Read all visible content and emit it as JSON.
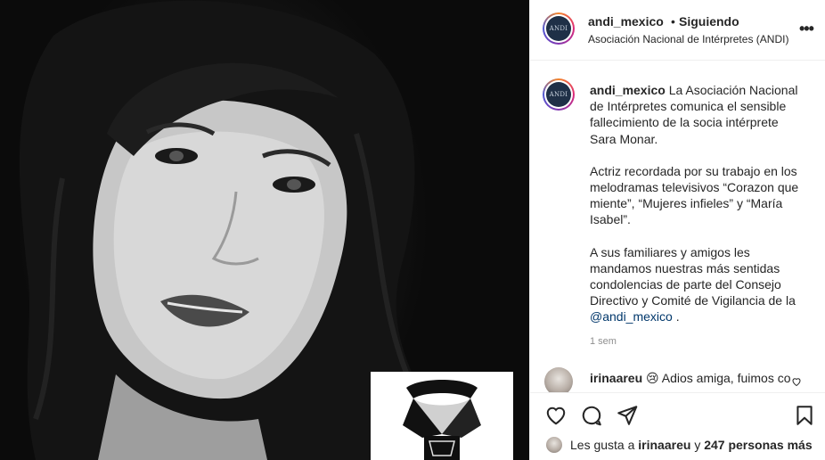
{
  "post": {
    "username": "andi_mexico",
    "separator": "•",
    "follow_status": "Siguiendo",
    "subtitle": "Asociación Nacional de Intérpretes (ANDI)",
    "more": "•••",
    "avatar_text": "ANDI"
  },
  "caption": {
    "username": "andi_mexico",
    "p1": "La Asociación Nacional de Intérpretes comunica el sensible fallecimiento de la socia intérprete Sara Monar.",
    "p2": "Actriz recordada por su trabajo en los melodramas televisivos “Corazon que miente”, “Mujeres infieles” y “María Isabel”.",
    "p3_text": "A sus familiares y amigos les mandamos nuestras más sentidas condolencias de parte del Consejo Directivo y Comité de Vigilancia de la",
    "p3_mention": "@andi_mexico",
    "p3_end": ".",
    "time_ago": "1 sem"
  },
  "comment": {
    "username": "irinaareu",
    "emoji": "😢",
    "text": "Adios amiga, fuimos compañeras de trabajo en"
  },
  "likes": {
    "prefix": "Les gusta a",
    "user": "irinaareu",
    "middle": "y",
    "count": "247 personas más"
  },
  "icons": {
    "like": "heart-icon",
    "comment": "comment-icon",
    "share": "share-icon",
    "save": "bookmark-icon",
    "comment_like": "small-heart-icon"
  }
}
